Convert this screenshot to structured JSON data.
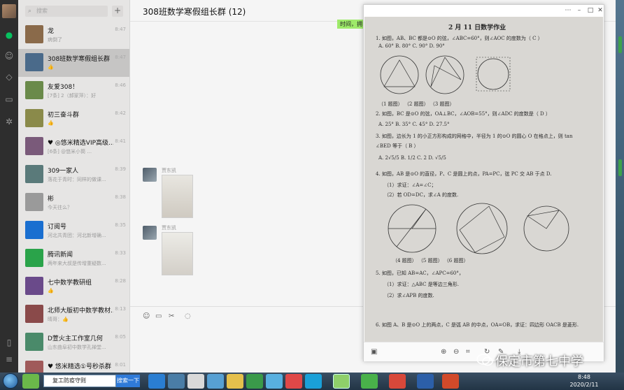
{
  "rail": {
    "icons": [
      "chat-icon",
      "contacts-icon",
      "favorites-icon",
      "folder-icon",
      "moments-icon",
      "phone-icon",
      "menu-icon"
    ]
  },
  "search": {
    "placeholder": "搜索",
    "add": "+"
  },
  "sessions": [
    {
      "name": "龙",
      "time": "8:47",
      "preview": "病倒了"
    },
    {
      "name": "308班数学寒假组长群",
      "time": "8:47",
      "preview": "👍"
    },
    {
      "name": "友爱308！",
      "time": "8:46",
      "preview": "[7条] 2（郝家萍）：好"
    },
    {
      "name": "初三奋斗群",
      "time": "8:42",
      "preview": "👍"
    },
    {
      "name": "♥ ◎悠米精选VIP高级...",
      "time": "8:41",
      "preview": "[6条] @悠米小筒 ..."
    },
    {
      "name": "309一家人",
      "time": "8:39",
      "preview": "落花于青时：同样的做课..."
    },
    {
      "name": "彬",
      "time": "8:38",
      "preview": "今天往么？"
    },
    {
      "name": "订阅号",
      "time": "8:35",
      "preview": "河北共青团：河北新增确..."
    },
    {
      "name": "腾讯新闻",
      "time": "8:33",
      "preview": "两年来大叔是传增重疑数..."
    },
    {
      "name": "七中数学教研组",
      "time": "8:28",
      "preview": "👍"
    },
    {
      "name": "北师大版初中数学教材...",
      "time": "8:13",
      "preview": "晴哥：👍"
    },
    {
      "name": "D萱火主工作室几何",
      "time": "8:05",
      "preview": "山东曲阜初中数学孔禅堂..."
    },
    {
      "name": "♥ 悠米精选①号秒杀群",
      "time": "8:01",
      "preview": ""
    }
  ],
  "chat": {
    "title": "308班数学寒假组长群 (12)",
    "green_bubble": "时间，拥",
    "messages": [
      {
        "sender": "贾东凯"
      },
      {
        "sender": "贾东凯"
      }
    ],
    "tools": [
      "emoji-icon",
      "folder-icon",
      "scissors-icon",
      "chat-history-icon"
    ]
  },
  "viewer": {
    "title_buttons": [
      "⋯",
      "–",
      "□",
      "✕"
    ],
    "paper": {
      "title": "2 月 11 日数学作业",
      "lines": [
        "1. 如图，AB、BC 都是⊙O 的弦，∠ABC=60°，则∠AOC 的度数为（ C ）",
        "A. 60°          B. 80°          C. 90°          D. 90°",
        "（1 题图）           （2 题图）          （3 题图）",
        "2. 如图，BC 是⊙O 的弦，OA⊥BC，∠AOB=55°，则∠ADC 的度数是（ D ）",
        "A. 25°          B. 35°          C. 45°          D. 27.5°",
        "3. 如图，边长为 1 的小正方形构成的网格中，半径为 1 的⊙O 的圆心 O 在格点上，则 tan",
        "∠BED 等于（ B ）",
        "A. 2√5/5          B. 1/2          C. 2          D. √5/5",
        "4. 如图，AB 是⊙O 的直径，P、C 是圆上的点，PA=PC，弦 PC 交 AB 于点 D.",
        "（1）求证：∠A=∠C；",
        "（2）若 OD=DC，求∠A 的度数.",
        "（4 题图）                      （5 题图）                （6 题图）",
        "5. 如图，已知 AB=AC，∠APC=60°，",
        "（1）求证：△ABC 是等边三角形.",
        "（2）求∠APB 的度数.",
        "6. 如图 A、B 是⊙O 上的两点，C 是弧 AB 的中点，OA=OB，求证：四边形 OACB 是菱形."
      ]
    },
    "toolbar": [
      "save-icon",
      "zoom-in-icon",
      "zoom-out-icon",
      "fit-icon",
      "rotate-icon",
      "edit-icon",
      "download-icon"
    ]
  },
  "taskbar": {
    "search_value": "复工防疫守则",
    "search_button": "搜索一下",
    "time": "8:48",
    "date": "2020/2/11"
  },
  "watermark": "保定市第七中学",
  "colors": {
    "wechat_green": "#07c160",
    "bubble_green": "#9eea6a",
    "rail": "#2e2e2e",
    "active_row": "#c6c5c4"
  }
}
